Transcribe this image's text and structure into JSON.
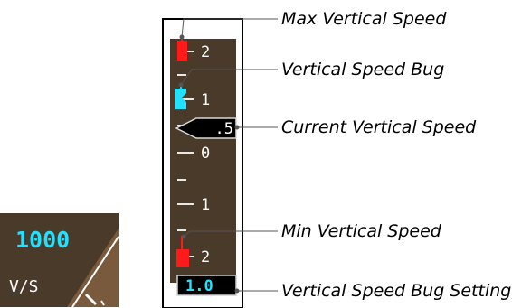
{
  "inset": {
    "selected_value": "1000",
    "mode_label": "V/S"
  },
  "tape": {
    "scale_labels": [
      "2",
      "1",
      "0",
      "1",
      "2"
    ],
    "current_value": ".5",
    "bug_setting": "1.0"
  },
  "callouts": {
    "max_vs": "Max Vertical Speed",
    "vs_bug": "Vertical Speed Bug",
    "current_vs": "Current Vertical Speed",
    "min_vs": "Min Vertical Speed",
    "bug_setting": "Vertical Speed Bug Setting"
  },
  "colors": {
    "tape_background": "#4a3a2a",
    "limit_marker": "#ff1a1a",
    "bug": "#22e0ff",
    "pointer": "#000000",
    "text": "#ffffff"
  }
}
